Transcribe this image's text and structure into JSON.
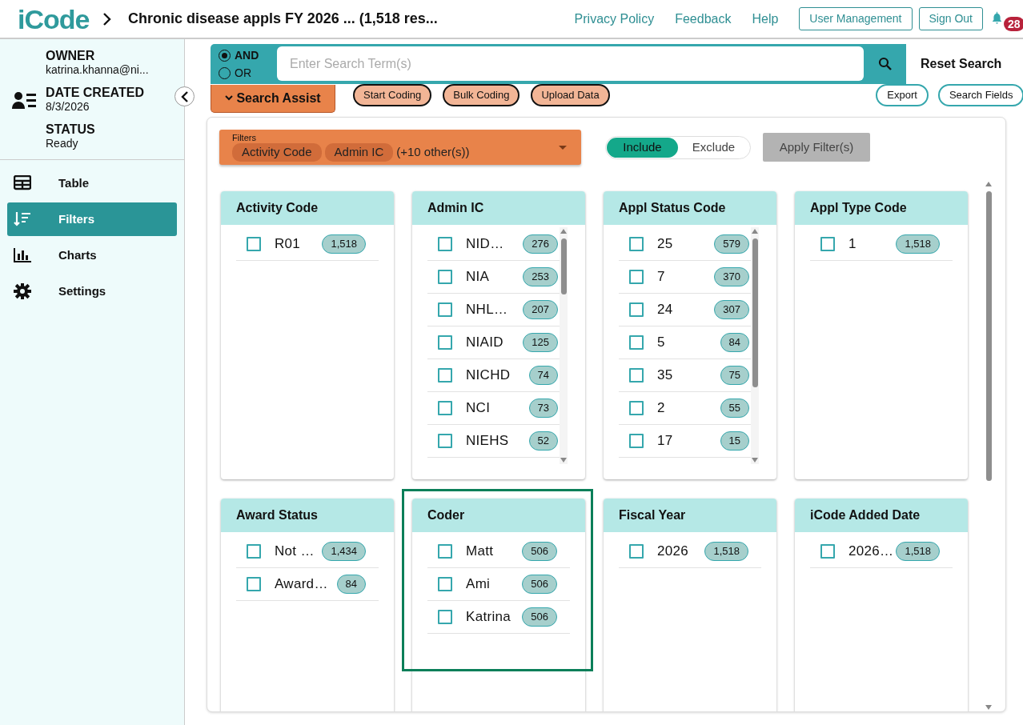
{
  "header": {
    "logo": "iCode",
    "title": "Chronic disease appls FY 2026 ... (1,518 res...",
    "links": [
      "Privacy Policy",
      "Feedback",
      "Help"
    ],
    "buttons": [
      "User Management",
      "Sign Out"
    ],
    "notifications": "28"
  },
  "sidebar": {
    "fields": [
      {
        "label": "OWNER",
        "value": "katrina.khanna@ni..."
      },
      {
        "label": "DATE CREATED",
        "value": "8/3/2026"
      },
      {
        "label": "STATUS",
        "value": "Ready"
      }
    ],
    "nav": [
      {
        "label": "Table",
        "kind": "table",
        "selected": false
      },
      {
        "label": "Filters",
        "kind": "filters",
        "selected": true
      },
      {
        "label": "Charts",
        "kind": "charts",
        "selected": false
      },
      {
        "label": "Settings",
        "kind": "settings",
        "selected": false
      }
    ]
  },
  "search": {
    "operators": [
      {
        "label": "AND",
        "selected": true
      },
      {
        "label": "OR",
        "selected": false
      }
    ],
    "placeholder": "Enter Search Term(s)",
    "reset": "Reset Search",
    "assist": "Search Assist",
    "actions": [
      "Start Coding",
      "Bulk Coding",
      "Upload Data"
    ],
    "tools": [
      "Export",
      "Search Fields"
    ]
  },
  "filters": {
    "label": "Filters",
    "chips": [
      "Activity Code",
      "Admin IC"
    ],
    "more": "(+10 other(s))",
    "modes": [
      {
        "label": "Include",
        "selected": true
      },
      {
        "label": "Exclude",
        "selected": false
      }
    ],
    "apply": {
      "label": "Apply Filter(s)",
      "disabled": true
    },
    "cards": [
      {
        "title": "Activity Code",
        "highlighted": false,
        "scrollable": false,
        "items": [
          {
            "label": "R01",
            "count": "1,518",
            "checked": false
          }
        ]
      },
      {
        "title": "Admin IC",
        "highlighted": false,
        "scrollable": true,
        "items": [
          {
            "label": "NID…",
            "count": "276",
            "checked": false
          },
          {
            "label": "NIA",
            "count": "253",
            "checked": false
          },
          {
            "label": "NHL…",
            "count": "207",
            "checked": false
          },
          {
            "label": "NIAID",
            "count": "125",
            "checked": false
          },
          {
            "label": "NICHD",
            "count": "74",
            "checked": false
          },
          {
            "label": "NCI",
            "count": "73",
            "checked": false
          },
          {
            "label": "NIEHS",
            "count": "52",
            "checked": false
          }
        ]
      },
      {
        "title": "Appl Status Code",
        "highlighted": false,
        "scrollable": true,
        "items": [
          {
            "label": "25",
            "count": "579",
            "checked": false
          },
          {
            "label": "7",
            "count": "370",
            "checked": false
          },
          {
            "label": "24",
            "count": "307",
            "checked": false
          },
          {
            "label": "5",
            "count": "84",
            "checked": false
          },
          {
            "label": "35",
            "count": "75",
            "checked": false
          },
          {
            "label": "2",
            "count": "55",
            "checked": false
          },
          {
            "label": "17",
            "count": "15",
            "checked": false
          }
        ]
      },
      {
        "title": "Appl Type Code",
        "highlighted": false,
        "scrollable": false,
        "items": [
          {
            "label": "1",
            "count": "1,518",
            "checked": false
          }
        ]
      },
      {
        "title": "Award Status",
        "highlighted": false,
        "scrollable": false,
        "items": [
          {
            "label": "Not …",
            "count": "1,434",
            "checked": false
          },
          {
            "label": "Award…",
            "count": "84",
            "checked": false
          }
        ]
      },
      {
        "title": "Coder",
        "highlighted": true,
        "scrollable": false,
        "items": [
          {
            "label": "Matt",
            "count": "506",
            "checked": false
          },
          {
            "label": "Ami",
            "count": "506",
            "checked": false
          },
          {
            "label": "Katrina",
            "count": "506",
            "checked": false
          }
        ]
      },
      {
        "title": "Fiscal Year",
        "highlighted": false,
        "scrollable": false,
        "items": [
          {
            "label": "2026",
            "count": "1,518",
            "checked": false
          }
        ]
      },
      {
        "title": "iCode Added Date",
        "highlighted": false,
        "scrollable": false,
        "items": [
          {
            "label": "2026…",
            "count": "1,518",
            "checked": false
          }
        ]
      }
    ]
  }
}
